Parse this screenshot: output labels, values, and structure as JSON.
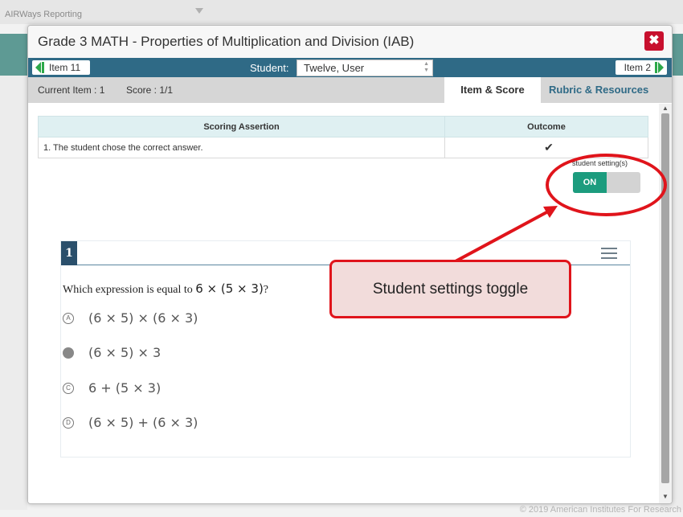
{
  "app": {
    "title": "AIRWays Reporting",
    "footer": "© 2019 American Institutes For Research"
  },
  "modal": {
    "title": "Grade 3 MATH - Properties of Multiplication and Division (IAB)",
    "close_icon": "close-icon"
  },
  "nav": {
    "prev_label": "Item 11",
    "next_label": "Item 2",
    "student_label": "Student:",
    "student_value": "Twelve, User"
  },
  "tabs": {
    "current_item": "Current Item : 1",
    "score": "Score : 1/1",
    "item_score": "Item & Score",
    "rubric": "Rubric & Resources"
  },
  "assertions": {
    "headers": [
      "Scoring Assertion",
      "Outcome"
    ],
    "rows": [
      {
        "assertion": "1. The student chose the correct answer.",
        "outcome": "✔"
      }
    ]
  },
  "student_setting": {
    "label": "student setting(s)",
    "toggle_state": "ON"
  },
  "item": {
    "number": "1",
    "question_prefix": "Which expression is equal to",
    "question_expr": "6 × (5 × 3)",
    "question_suffix": "?",
    "options": [
      {
        "letter": "A",
        "text": "(6 × 5) × (6 × 3)",
        "selected": false
      },
      {
        "letter": "B",
        "text": "(6 × 5) × 3",
        "selected": true
      },
      {
        "letter": "C",
        "text": "6 + (5 × 3)",
        "selected": false
      },
      {
        "letter": "D",
        "text": "(6 × 5) + (6 × 3)",
        "selected": false
      }
    ]
  },
  "annotation": {
    "callout_text": "Student settings toggle",
    "color": "#e0141b"
  }
}
